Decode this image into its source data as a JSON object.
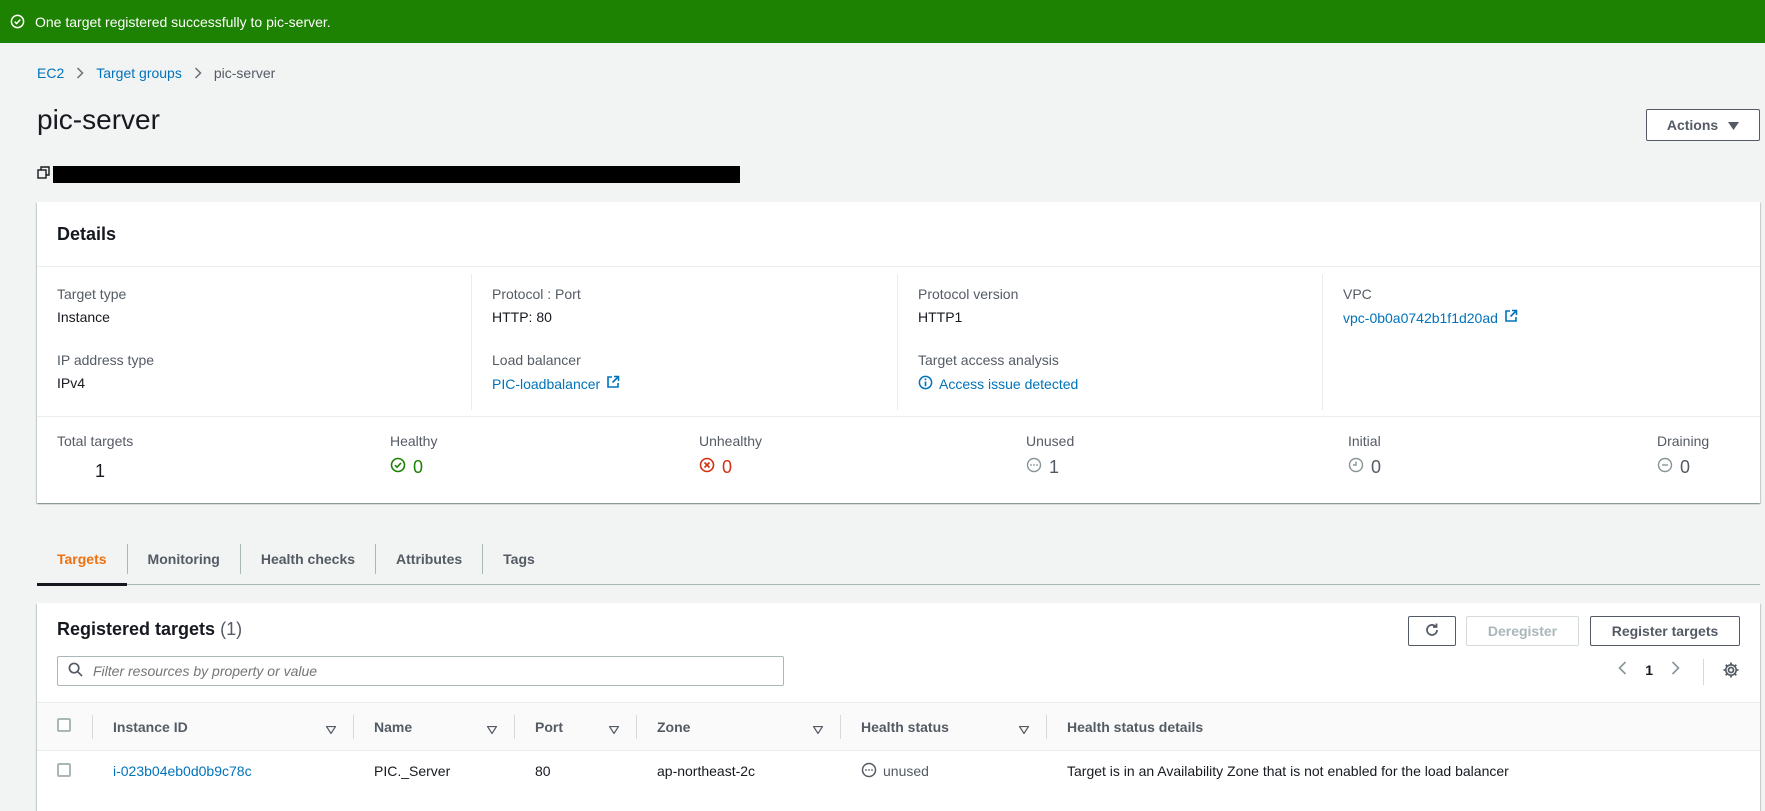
{
  "flash": {
    "message": "One target registered successfully to pic-server."
  },
  "breadcrumb": {
    "items": [
      "EC2",
      "Target groups",
      "pic-server"
    ]
  },
  "page": {
    "title": "pic-server",
    "actions_label": "Actions"
  },
  "details": {
    "heading": "Details",
    "fields": {
      "target_type": {
        "label": "Target type",
        "value": "Instance"
      },
      "ip_address_type": {
        "label": "IP address type",
        "value": "IPv4"
      },
      "protocol_port": {
        "label": "Protocol : Port",
        "value": "HTTP: 80"
      },
      "load_balancer": {
        "label": "Load balancer",
        "value": "PIC-loadbalancer"
      },
      "protocol_version": {
        "label": "Protocol version",
        "value": "HTTP1"
      },
      "target_access": {
        "label": "Target access analysis",
        "value": "Access issue detected"
      },
      "vpc": {
        "label": "VPC",
        "value": "vpc-0b0a0742b1f1d20ad"
      }
    },
    "stats": {
      "total": {
        "label": "Total targets",
        "value": "1"
      },
      "healthy": {
        "label": "Healthy",
        "value": "0"
      },
      "unhealthy": {
        "label": "Unhealthy",
        "value": "0"
      },
      "unused": {
        "label": "Unused",
        "value": "1"
      },
      "initial": {
        "label": "Initial",
        "value": "0"
      },
      "draining": {
        "label": "Draining",
        "value": "0"
      }
    }
  },
  "tabs": [
    "Targets",
    "Monitoring",
    "Health checks",
    "Attributes",
    "Tags"
  ],
  "targets": {
    "title": "Registered targets",
    "count": "(1)",
    "deregister_label": "Deregister",
    "register_label": "Register targets",
    "search_placeholder": "Filter resources by property or value",
    "page_number": "1",
    "columns": [
      "Instance ID",
      "Name",
      "Port",
      "Zone",
      "Health status",
      "Health status details"
    ],
    "rows": [
      {
        "instance_id": "i-023b04eb0d0b9c78c",
        "name": "PIC._Server",
        "port": "80",
        "zone": "ap-northeast-2c",
        "health_status": "unused",
        "health_details": "Target is in an Availability Zone that is not enabled for the load balancer"
      }
    ]
  },
  "colors": {
    "success": "#1d8102",
    "error": "#d13212",
    "link": "#0073bb",
    "accent_tab": "#ec7211",
    "neutral": "#687078"
  }
}
